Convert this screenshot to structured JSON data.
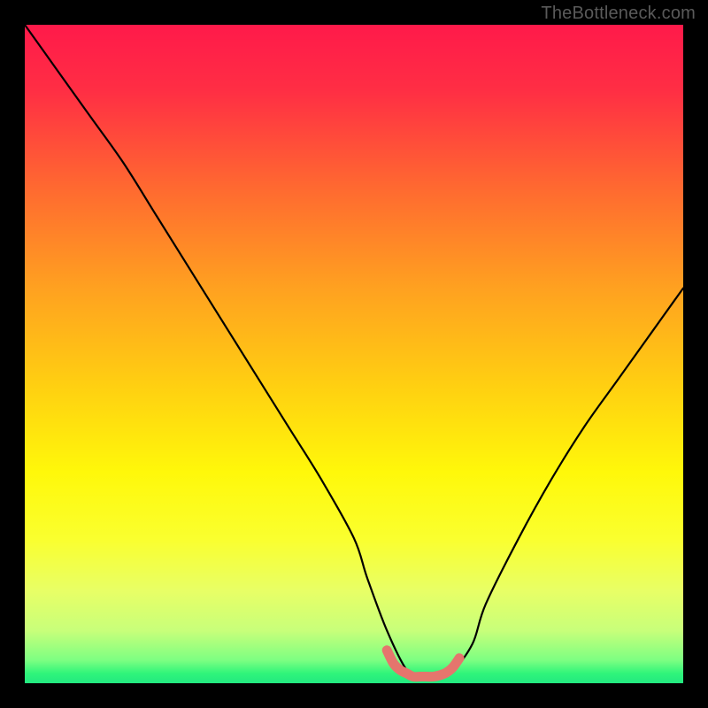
{
  "watermark": "TheBottleneck.com",
  "chart_data": {
    "type": "line",
    "title": "",
    "xlabel": "",
    "ylabel": "",
    "xlim": [
      0,
      100
    ],
    "ylim": [
      0,
      100
    ],
    "series": [
      {
        "name": "bottleneck-curve",
        "x": [
          0,
          5,
          10,
          15,
          20,
          25,
          30,
          35,
          40,
          45,
          50,
          52,
          55,
          58,
          60,
          62,
          65,
          68,
          70,
          75,
          80,
          85,
          90,
          95,
          100
        ],
        "values": [
          100,
          93,
          86,
          79,
          71,
          63,
          55,
          47,
          39,
          31,
          22,
          16,
          8,
          2,
          1,
          1,
          2,
          6,
          12,
          22,
          31,
          39,
          46,
          53,
          60
        ]
      },
      {
        "name": "bottom-highlight",
        "x": [
          55,
          56,
          57,
          58,
          59,
          60,
          61,
          62,
          63,
          64,
          65,
          66
        ],
        "values": [
          5,
          3,
          2,
          1.5,
          1,
          1,
          1,
          1,
          1.2,
          1.6,
          2.4,
          3.8
        ]
      }
    ],
    "gradient_stops": [
      {
        "offset": 0.0,
        "color": "#ff1a4a"
      },
      {
        "offset": 0.1,
        "color": "#ff2e44"
      },
      {
        "offset": 0.25,
        "color": "#ff6a30"
      },
      {
        "offset": 0.4,
        "color": "#ffa120"
      },
      {
        "offset": 0.55,
        "color": "#ffd011"
      },
      {
        "offset": 0.68,
        "color": "#fff80a"
      },
      {
        "offset": 0.78,
        "color": "#faff2e"
      },
      {
        "offset": 0.86,
        "color": "#e8ff66"
      },
      {
        "offset": 0.92,
        "color": "#c8ff7a"
      },
      {
        "offset": 0.965,
        "color": "#7dff82"
      },
      {
        "offset": 0.985,
        "color": "#30f57a"
      },
      {
        "offset": 1.0,
        "color": "#22e880"
      }
    ]
  }
}
